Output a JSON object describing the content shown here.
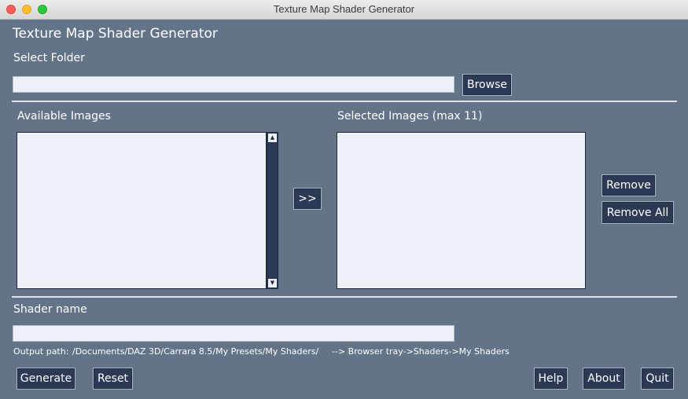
{
  "window": {
    "title": "Texture Map Shader Generator"
  },
  "app": {
    "heading": "Texture Map Shader Generator",
    "select_folder_label": "Select Folder",
    "folder_value": "",
    "browse_label": "Browse",
    "available_label": "Available Images",
    "selected_label": "Selected Images (max 11)",
    "add_label": ">>",
    "remove_label": "Remove",
    "remove_all_label": "Remove All",
    "shader_name_label": "Shader name",
    "shader_name_value": "",
    "output_path_label": "Output path:",
    "output_path_value": "/Documents/DAZ 3D/Carrara 8.5/My Presets/My Shaders/",
    "browser_tray_hint": "--> Browser tray->Shaders->My Shaders",
    "generate_label": "Generate",
    "reset_label": "Reset",
    "help_label": "Help",
    "about_label": "About",
    "quit_label": "Quit"
  },
  "colors": {
    "background": "#637489",
    "button": "#2d3a56",
    "field": "#eef1f7"
  }
}
